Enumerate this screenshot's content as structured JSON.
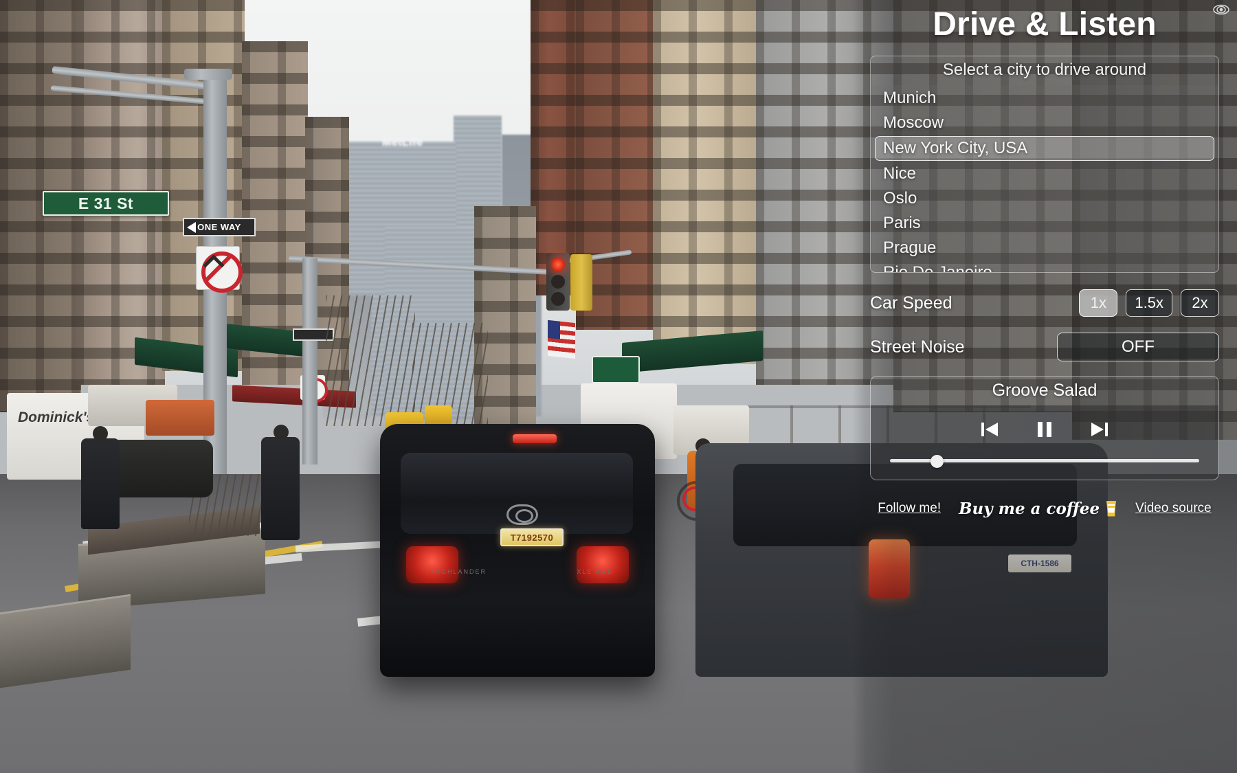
{
  "app": {
    "title": "Drive & Listen",
    "hide_ui_icon": "eye-icon"
  },
  "city_selector": {
    "title": "Select a city to drive around",
    "selected": "New York City, USA",
    "items": [
      {
        "label": "Munich",
        "selected": false
      },
      {
        "label": "Moscow",
        "selected": false
      },
      {
        "label": "New York City, USA",
        "selected": true
      },
      {
        "label": "Nice",
        "selected": false
      },
      {
        "label": "Oslo",
        "selected": false
      },
      {
        "label": "Paris",
        "selected": false
      },
      {
        "label": "Prague",
        "selected": false
      },
      {
        "label": "Rio De Janeiro",
        "selected": false
      }
    ]
  },
  "car_speed": {
    "label": "Car Speed",
    "options": [
      {
        "label": "1x",
        "active": true
      },
      {
        "label": "1.5x",
        "active": false
      },
      {
        "label": "2x",
        "active": false
      }
    ]
  },
  "street_noise": {
    "label": "Street Noise",
    "value": "OFF"
  },
  "player": {
    "station": "Groove Salad",
    "prev_icon": "skip-previous-icon",
    "playpause_icon": "pause-icon",
    "next_icon": "skip-next-icon",
    "volume_percent": 15
  },
  "footer": {
    "follow_label": "Follow me!",
    "coffee_label": "Buy me a coffee",
    "coffee_icon": "coffee-cup-icon",
    "video_source_label": "Video source"
  },
  "scene": {
    "street_sign": "E 31 St",
    "one_way_sign": "ONE WAY",
    "building_sign": "MetLife",
    "truck_brand": "Dominick's",
    "lead_car_plate": "T7192570",
    "right_car_plate": "CTH-1586",
    "traffic_light_state": "red"
  },
  "colors": {
    "panel_overlay": "#181a1c",
    "accent_white": "#ffffff",
    "selected_item_bg": "#c8c8c8",
    "street_sign_green": "#1f5d3a",
    "brake_red": "#c4241a",
    "coffee_yellow": "#f0c433"
  }
}
